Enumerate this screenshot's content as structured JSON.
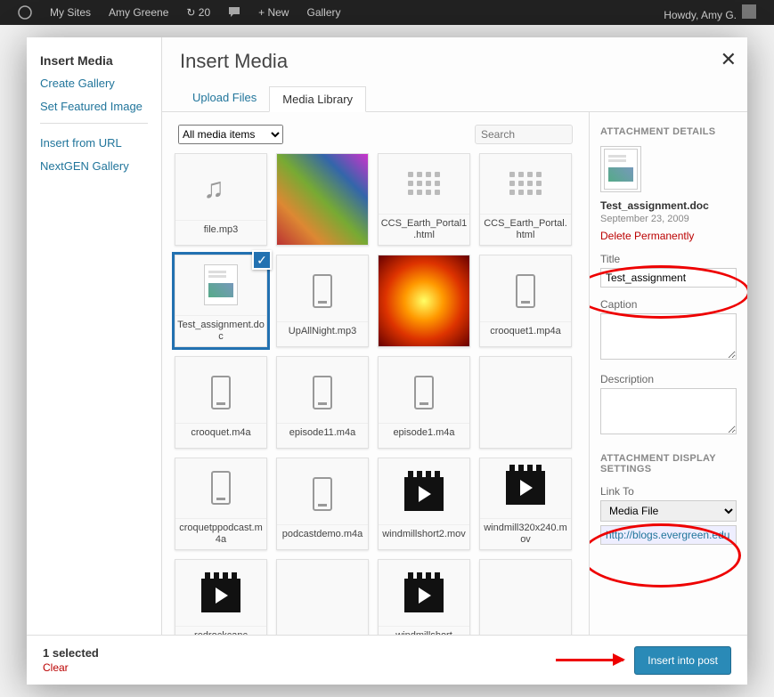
{
  "toolbar": {
    "mysites": "My Sites",
    "sitename": "Amy Greene",
    "updates": "20",
    "new": "New",
    "gallery": "Gallery",
    "howdy": "Howdy, Amy G."
  },
  "sidebar": {
    "title": "Insert Media",
    "links": [
      "Create Gallery",
      "Set Featured Image",
      "Insert from URL",
      "NextGEN Gallery"
    ]
  },
  "modal": {
    "title": "Insert Media",
    "tabs": [
      "Upload Files",
      "Media Library"
    ],
    "active_tab": 1,
    "filter_options": [
      "All media items"
    ],
    "filter_selected": "All media items",
    "search_placeholder": "Search"
  },
  "items": [
    {
      "name": "file.mp3",
      "type": "audio"
    },
    {
      "name": "",
      "type": "img-muppets"
    },
    {
      "name": "CCS_Earth_Portal1.html",
      "type": "html"
    },
    {
      "name": "CCS_Earth_Portal.html",
      "type": "html"
    },
    {
      "name": "Test_assignment.doc",
      "type": "doc",
      "selected": true
    },
    {
      "name": "UpAllNight.mp3",
      "type": "media"
    },
    {
      "name": "",
      "type": "img-sun"
    },
    {
      "name": "crooquet1.mp4a",
      "type": "media"
    },
    {
      "name": "crooquet.m4a",
      "type": "media"
    },
    {
      "name": "episode11.m4a",
      "type": "media"
    },
    {
      "name": "episode1.m4a",
      "type": "media"
    },
    {
      "name": "",
      "type": "blank"
    },
    {
      "name": "croquetppodcast.m4a",
      "type": "media"
    },
    {
      "name": "podcastdemo.m4a",
      "type": "media"
    },
    {
      "name": "windmillshort2.mov",
      "type": "video"
    },
    {
      "name": "windmill320x240.mov",
      "type": "video"
    },
    {
      "name": "redrockcanc",
      "type": "video"
    },
    {
      "name": "",
      "type": "blank"
    },
    {
      "name": "windmillshort",
      "type": "video"
    },
    {
      "name": "",
      "type": "blank"
    }
  ],
  "details": {
    "heading": "ATTACHMENT DETAILS",
    "filename": "Test_assignment.doc",
    "date": "September 23, 2009",
    "delete": "Delete Permanently",
    "title_label": "Title",
    "title_value": "Test_assignment",
    "caption_label": "Caption",
    "caption_value": "",
    "description_label": "Description",
    "description_value": "",
    "display_heading": "ATTACHMENT DISPLAY SETTINGS",
    "linkto_label": "Link To",
    "linkto_options": [
      "Media File"
    ],
    "linkto_selected": "Media File",
    "url_value": "http://blogs.evergreen.edu"
  },
  "footer": {
    "selected_text": "1 selected",
    "clear": "Clear",
    "insert_btn": "Insert into post"
  }
}
